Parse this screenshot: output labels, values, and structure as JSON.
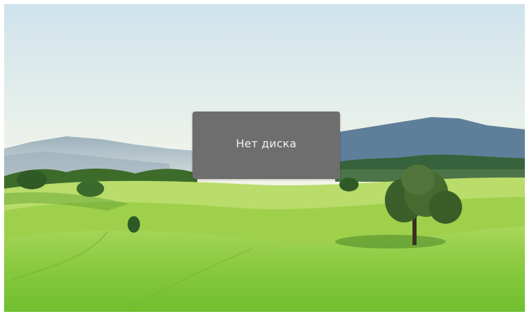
{
  "screen": {
    "wallpaper": "green-hills-landscape",
    "colors": {
      "sky_top": "#cfe3ec",
      "sky_bottom": "#f3f5ea",
      "mountains": "#5a7b9a",
      "grass_light": "#b7e05a",
      "grass_dark": "#5fae2a",
      "dialog_bg": "#6e6e6e",
      "dialog_text": "#f2f2f2"
    }
  },
  "dialog": {
    "message": "Нет диска"
  }
}
